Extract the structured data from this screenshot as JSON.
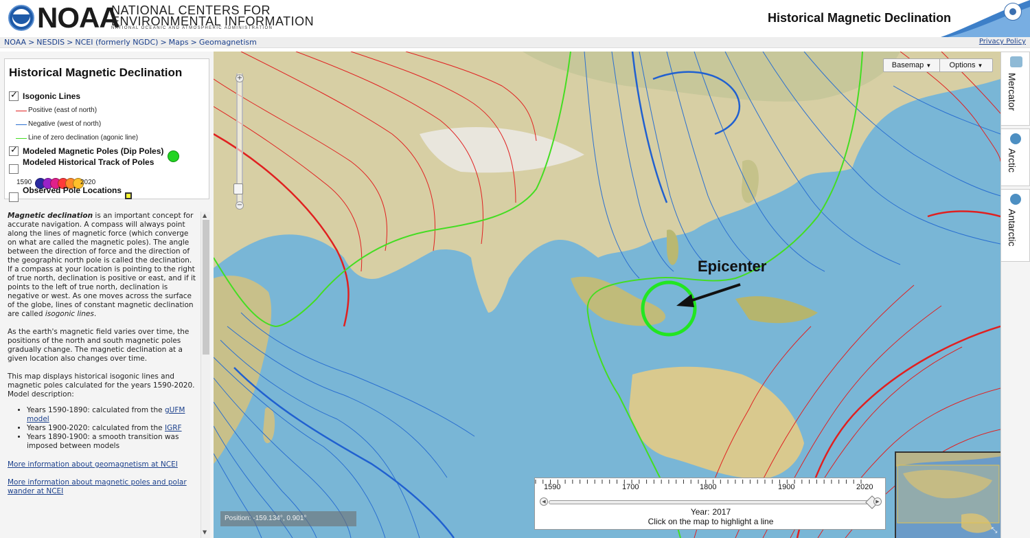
{
  "header": {
    "logo_word": "NOAA",
    "org_line1": "NATIONAL CENTERS FOR",
    "org_line2": "ENVIRONMENTAL INFORMATION",
    "org_line3": "NATIONAL OCEANIC AND ATMOSPHERIC ADMINISTRATION",
    "page_title": "Historical Magnetic Declination"
  },
  "breadcrumb": {
    "items": [
      "NOAA",
      "NESDIS",
      "NCEI (formerly NGDC)",
      "Maps",
      "Geomagnetism"
    ],
    "separator": ">",
    "privacy": "Privacy Policy"
  },
  "legend": {
    "title": "Historical Magnetic Declination",
    "isogonic": {
      "label": "Isogonic Lines",
      "checked": true
    },
    "positive": {
      "label": "Positive (east of north)",
      "color": "#e02020"
    },
    "negative": {
      "label": "Negative (west of north)",
      "color": "#2a6fd0"
    },
    "agonic": {
      "label": "Line of zero declination (agonic line)",
      "color": "#44dd22"
    },
    "dip_poles": {
      "label": "Modeled Magnetic Poles (Dip Poles)",
      "checked": true,
      "color": "#22d422"
    },
    "track": {
      "label": "Modeled Historical Track of Poles",
      "checked": false,
      "year_start": "1590",
      "year_end": "2020",
      "colors": [
        "#2a2aa0",
        "#9a22c8",
        "#e0208a",
        "#ff3a3a",
        "#ff8a2a",
        "#ffc02a"
      ]
    },
    "observed": {
      "label": "Observed Pole Locations",
      "checked": false,
      "color": "#ffff33"
    }
  },
  "description": {
    "p1_lead": "Magnetic declination",
    "p1_rest": " is an important concept for accurate navigation. A compass will always point along the lines of magnetic force (which converge on what are called the magnetic poles). The angle between the direction of force and the direction of the geographic north pole is called the declination. If a compass at your location is pointing to the right of true north, declination is positive or east, and if it points to the left of true north, declination is negative or west. As one moves across the surface of the globe, lines of constant magnetic declination are called ",
    "p1_italic": "isogonic lines",
    "p1_end": ".",
    "p2": "As the earth's magnetic field varies over time, the positions of the north and south magnetic poles gradually change. The magnetic declination at a given location also changes over time.",
    "p3": "This map displays historical isogonic lines and magnetic poles calculated for the years 1590-2020.",
    "p3_b": "Model description:",
    "bullet1_text": "Years 1590-1890: calculated from the ",
    "bullet1_link": "gUFM model",
    "bullet2_text": "Years 1900-2020: calculated from the ",
    "bullet2_link": "IGRF",
    "bullet3_text": "Years 1890-1900: a smooth transition was imposed between models",
    "link1": "More information about geomagnetism at NCEI",
    "link2": "More information about magnetic poles and polar wander at NCEI"
  },
  "map": {
    "basemap_label": "Basemap",
    "options_label": "Options",
    "annotation": "Epicenter",
    "position_label": "Position:",
    "position_value": "-159.134°, 0.901°",
    "zoom_plus": "+",
    "zoom_minus": "−",
    "dropdown_glyph": "▼",
    "resize_glyph": "⤡"
  },
  "timeline": {
    "tick_labels": [
      "1590",
      "1700",
      "1800",
      "1900",
      "2020"
    ],
    "year_min": 1590,
    "year_max": 2020,
    "current_year": 2017,
    "year_label": "Year:",
    "year_value": "2017",
    "hint": "Click on the map to highlight a line",
    "arrow_left": "◀",
    "arrow_right": "▶"
  },
  "projections": [
    {
      "label": "Mercator",
      "icon": "map-icon"
    },
    {
      "label": "Arctic",
      "icon": "globe-icon"
    },
    {
      "label": "Antarctic",
      "icon": "globe-icon"
    }
  ]
}
